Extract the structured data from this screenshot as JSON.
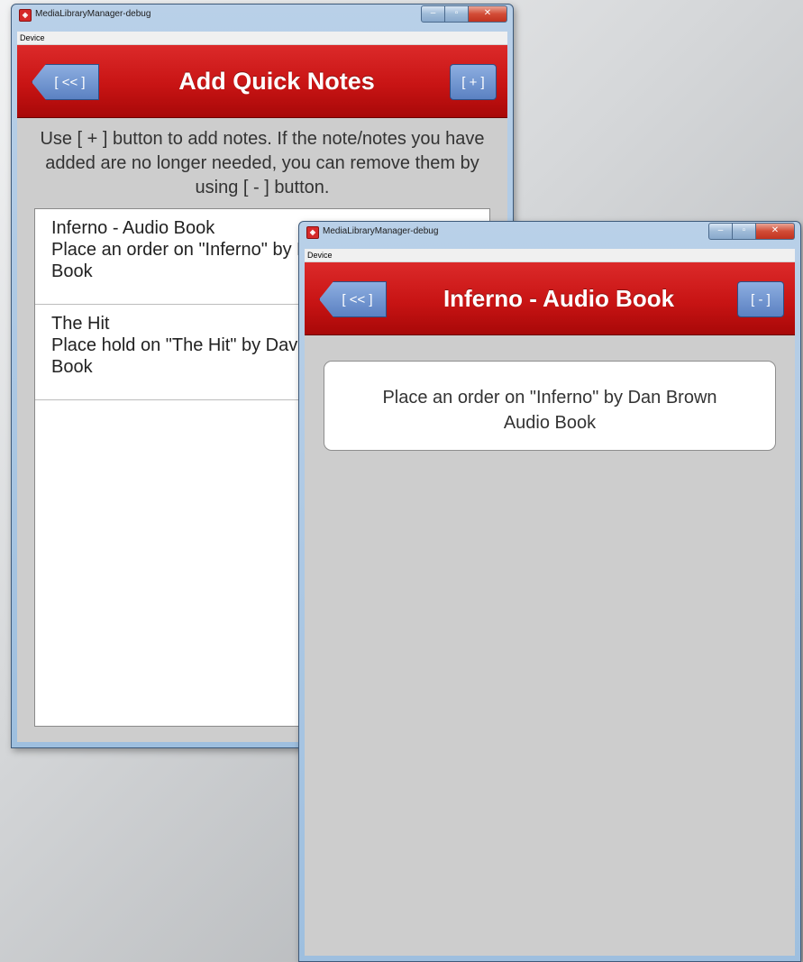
{
  "window1": {
    "title": "MediaLibraryManager-debug",
    "menu": "Device",
    "app_bar": {
      "back_label": "[ << ]",
      "title": "Add Quick Notes",
      "action_label": "[ + ]"
    },
    "instructions": "Use [ + ] button to add notes. If the note/notes you have added are no longer needed, you can remove them by using [ - ] button.",
    "notes": [
      {
        "title": "Inferno - Audio Book",
        "text": "Place an order on \"Inferno\" by Dan Brown Audio Book"
      },
      {
        "title": "The Hit",
        "text": "Place hold on \"The Hit\" by David Baldacci Audio Book"
      }
    ]
  },
  "window2": {
    "title": "MediaLibraryManager-debug",
    "menu": "Device",
    "app_bar": {
      "back_label": "[ << ]",
      "title": "Inferno - Audio Book",
      "action_label": "[ - ]"
    },
    "note_text": "Place an order on \"Inferno\" by Dan Brown Audio Book"
  },
  "colors": {
    "app_bar": "#c81414",
    "button_blue": "#6c90cf",
    "client_bg": "#cdcdcd"
  },
  "icons": [
    "app-icon",
    "minimize-icon",
    "maximize-icon",
    "close-icon"
  ]
}
